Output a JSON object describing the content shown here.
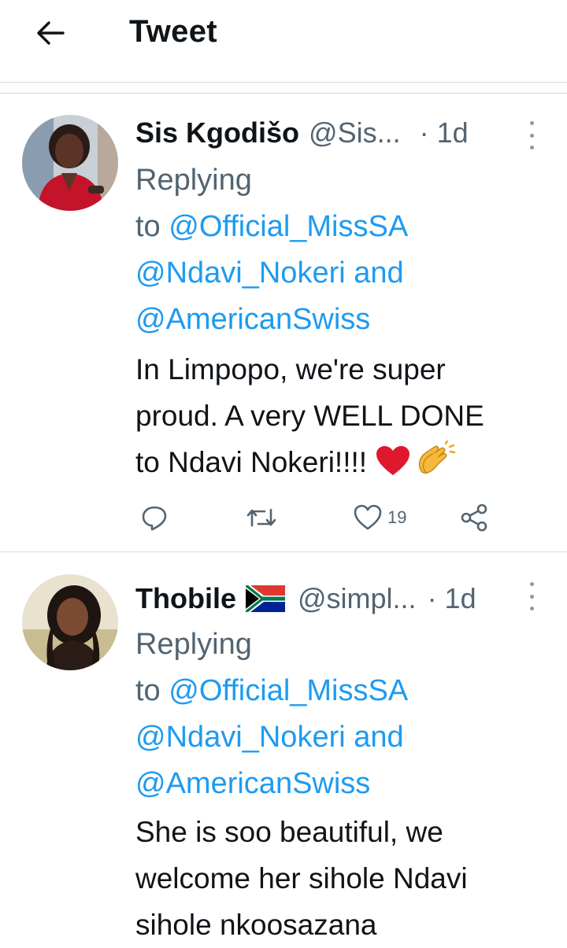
{
  "header": {
    "back_icon": "arrow-left-icon",
    "title": "Tweet"
  },
  "tweets": [
    {
      "display_name": "Sis Kgodišo",
      "handle": "@Sis...",
      "time": "· 1d",
      "reply_prefix_1": "Replying",
      "reply_prefix_2": "to ",
      "mentions": [
        "@Official_MissSA",
        "@Ndavi_Nokeri",
        "@AmericanSwiss"
      ],
      "and_word": " and",
      "body_lines": [
        "In Limpopo, we're super",
        "proud. A very WELL DONE",
        "to Ndavi Nokeri!!!! "
      ],
      "emojis": [
        "red-heart-icon",
        "clapping-hands-icon"
      ],
      "actions": {
        "reply_icon": "reply-icon",
        "retweet_icon": "retweet-icon",
        "like_icon": "heart-icon",
        "like_count": "19",
        "share_icon": "share-icon"
      }
    },
    {
      "display_name": "Thobile",
      "flag": "south-africa-flag-icon",
      "handle": "@simpl...",
      "time": "· 1d",
      "reply_prefix_1": "Replying",
      "reply_prefix_2": "to ",
      "mentions": [
        "@Official_MissSA",
        "@Ndavi_Nokeri",
        "@AmericanSwiss"
      ],
      "and_word": " and",
      "body_lines": [
        "She is soo beautiful, we",
        "welcome her sihole Ndavi",
        "sihole nkoosazana "
      ]
    }
  ],
  "colors": {
    "link": "#1d9bf0",
    "secondary_text": "#536471",
    "divider": "#d4d9dd"
  }
}
